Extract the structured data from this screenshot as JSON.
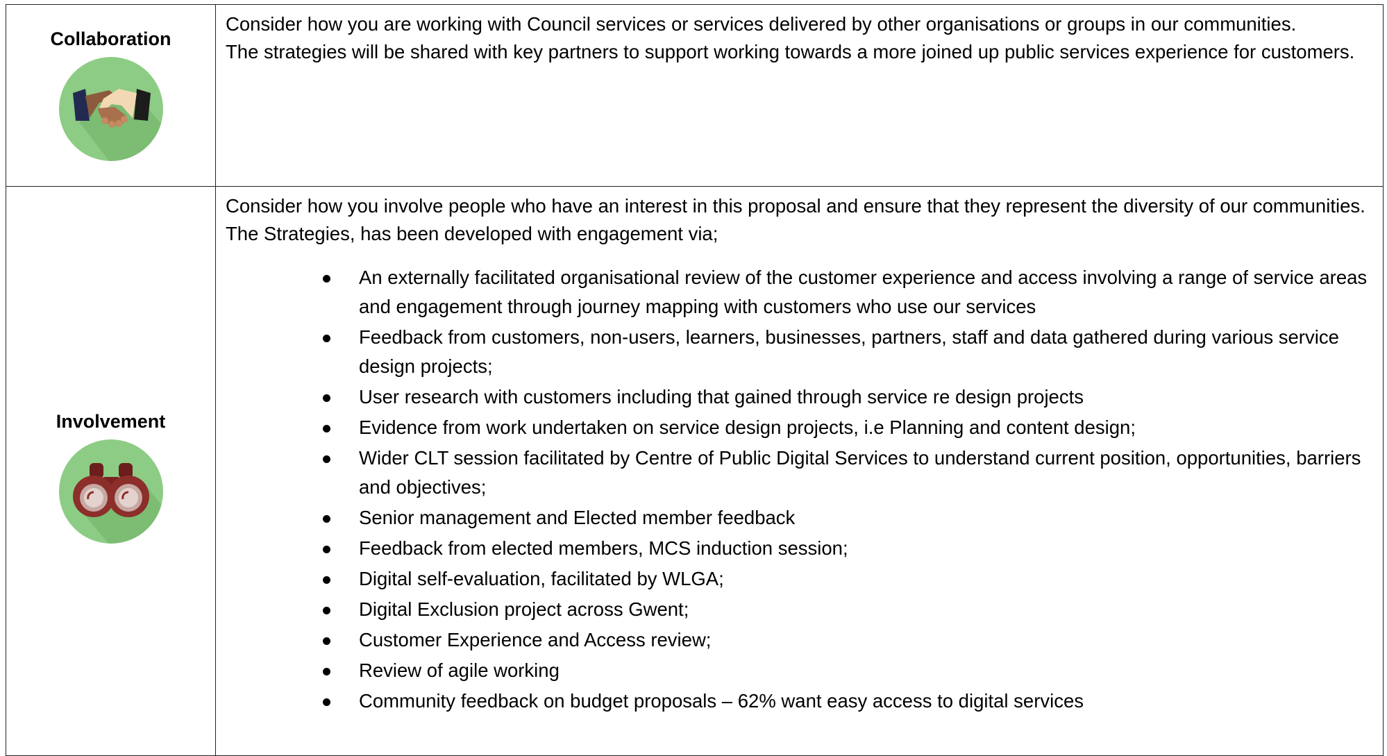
{
  "rows": [
    {
      "label": "Collaboration",
      "icon": "handshake-icon",
      "paragraphs": [
        "Consider how you are working with Council services or services delivered by other organisations or groups in our communities.",
        "The strategies will be shared with key partners to support working towards a more joined up public services experience for customers."
      ]
    },
    {
      "label": "Involvement",
      "icon": "binoculars-icon",
      "paragraphs": [
        "Consider how you involve people who have an interest in this proposal and ensure that they represent the diversity of our communities.",
        "The Strategies, has been developed with engagement via;"
      ],
      "bullets": [
        "An externally facilitated organisational review of the customer experience and access involving a range of service areas and engagement through journey mapping with customers who use our services",
        "Feedback from customers, non-users, learners, businesses, partners, staff and data gathered during various service design projects;",
        "User research with customers including that gained through service re design projects",
        "Evidence from work undertaken on service design projects, i.e Planning and content design;",
        "Wider CLT session facilitated by Centre of Public Digital Services to understand current position, opportunities, barriers and objectives;",
        "Senior management and Elected member feedback",
        "Feedback from elected members, MCS induction session;",
        "Digital self-evaluation, facilitated by WLGA;",
        "Digital Exclusion project across Gwent;",
        "Customer Experience and Access review;",
        "Review of agile working",
        "Community feedback on budget proposals – 62% want easy access to digital services"
      ]
    }
  ],
  "colors": {
    "icon_circle": "#8dcc84",
    "border": "#222222"
  }
}
